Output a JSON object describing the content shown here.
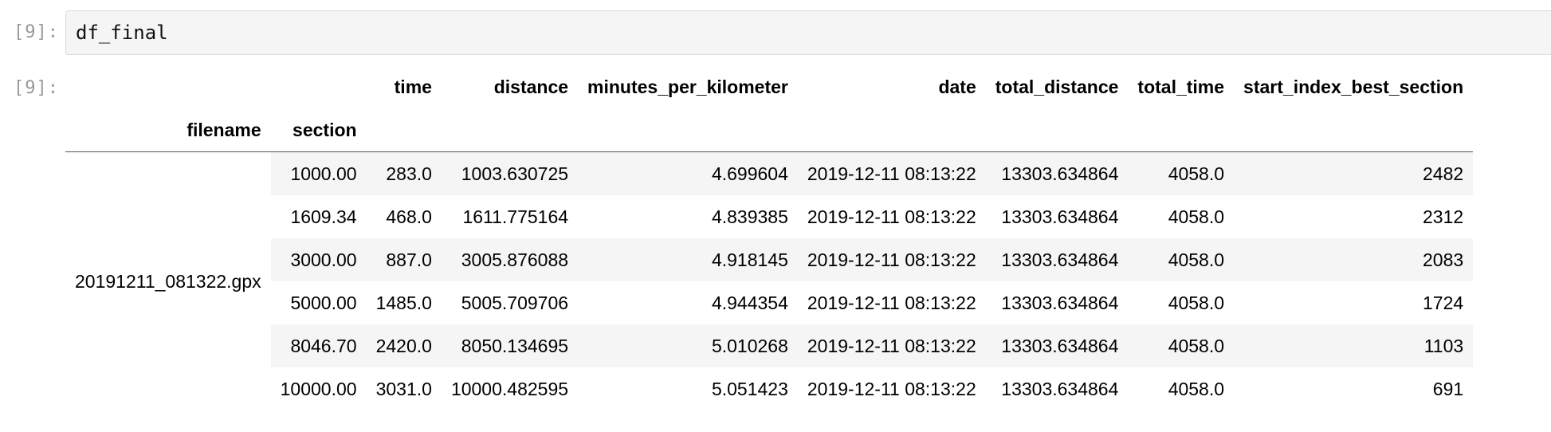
{
  "cell": {
    "input_prompt": "[9]:",
    "output_prompt": "[9]:",
    "code": "df_final"
  },
  "table": {
    "columns": [
      "time",
      "distance",
      "minutes_per_kilometer",
      "date",
      "total_distance",
      "total_time",
      "start_index_best_section"
    ],
    "index_names": [
      "filename",
      "section"
    ],
    "group_label": "20191211_081322.gpx",
    "rows": [
      {
        "section": "1000.00",
        "values": [
          "283.0",
          "1003.630725",
          "4.699604",
          "2019-12-11 08:13:22",
          "13303.634864",
          "4058.0",
          "2482"
        ]
      },
      {
        "section": "1609.34",
        "values": [
          "468.0",
          "1611.775164",
          "4.839385",
          "2019-12-11 08:13:22",
          "13303.634864",
          "4058.0",
          "2312"
        ]
      },
      {
        "section": "3000.00",
        "values": [
          "887.0",
          "3005.876088",
          "4.918145",
          "2019-12-11 08:13:22",
          "13303.634864",
          "4058.0",
          "2083"
        ]
      },
      {
        "section": "5000.00",
        "values": [
          "1485.0",
          "5005.709706",
          "4.944354",
          "2019-12-11 08:13:22",
          "13303.634864",
          "4058.0",
          "1724"
        ]
      },
      {
        "section": "8046.70",
        "values": [
          "2420.0",
          "8050.134695",
          "5.010268",
          "2019-12-11 08:13:22",
          "13303.634864",
          "4058.0",
          "1103"
        ]
      },
      {
        "section": "10000.00",
        "values": [
          "3031.0",
          "10000.482595",
          "5.051423",
          "2019-12-11 08:13:22",
          "13303.634864",
          "4058.0",
          "691"
        ]
      }
    ]
  }
}
